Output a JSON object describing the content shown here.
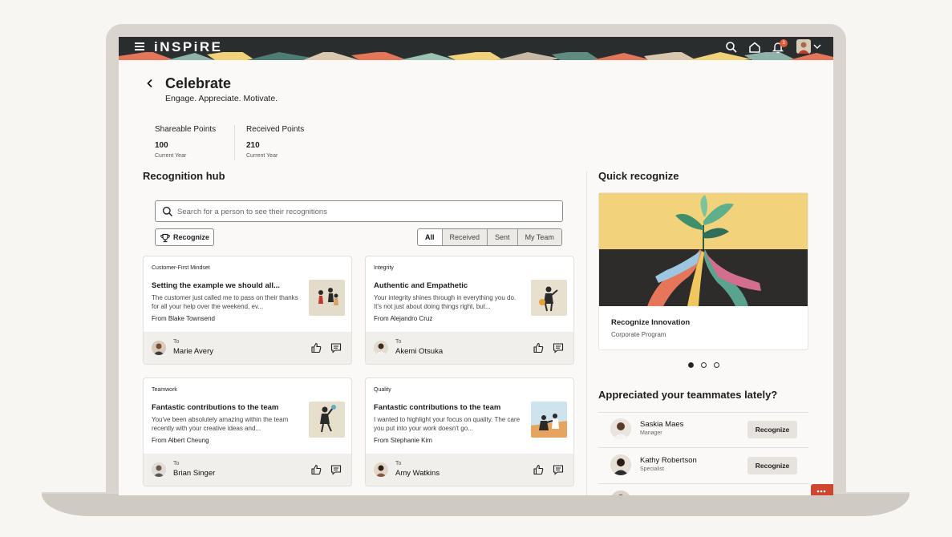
{
  "app": {
    "logo": "iNSPiRE",
    "notification_count": "3"
  },
  "page": {
    "title": "Celebrate",
    "subtitle": "Engage. Appreciate. Motivate."
  },
  "points": {
    "shareable": {
      "label": "Shareable Points",
      "value": "100",
      "period": "Current Year"
    },
    "received": {
      "label": "Received Points",
      "value": "210",
      "period": "Current Year"
    }
  },
  "hub": {
    "title": "Recognition hub",
    "search_placeholder": "Search for a person to see their recognitions",
    "recognize_label": "Recognize",
    "filters": [
      "All",
      "Received",
      "Sent",
      "My Team"
    ],
    "to_label": "To",
    "cards": [
      {
        "category": "Customer-First Mindset",
        "title": "Setting the example we should all...",
        "body": "The customer just called me to pass on their thanks for all your help over the weekend, ev...",
        "from": "From Blake Townsend",
        "to": "Marie Avery"
      },
      {
        "category": "Integrity",
        "title": "Authentic and Empathetic",
        "body": "Your integrity shines through in everything you do. It's not just about doing things right, but...",
        "from": "From Alejandro Cruz",
        "to": "Akemi Otsuka"
      },
      {
        "category": "Teamwork",
        "title": "Fantastic contributions to the team",
        "body": "You've been absolutely amazing within the team recently with your creative ideas and...",
        "from": "From Albert Cheung",
        "to": "Brian Singer"
      },
      {
        "category": "Quality",
        "title": "Fantastic contributions to the team",
        "body": "I wanted to highlight your focus on quality. The care you put into your work doesn't go...",
        "from": "From Stephanie Kim",
        "to": "Amy Watkins"
      }
    ]
  },
  "quick": {
    "title": "Quick recognize",
    "promo_title": "Recognize Innovation",
    "promo_subtitle": "Corporate Program",
    "carousel_active": 0,
    "teammates_title": "Appreciated your teammates lately?",
    "recognize_label": "Recognize",
    "teammates": [
      {
        "name": "Saskia Maes",
        "role": "Manager"
      },
      {
        "name": "Kathy Robertson",
        "role": "Specialist"
      }
    ]
  }
}
